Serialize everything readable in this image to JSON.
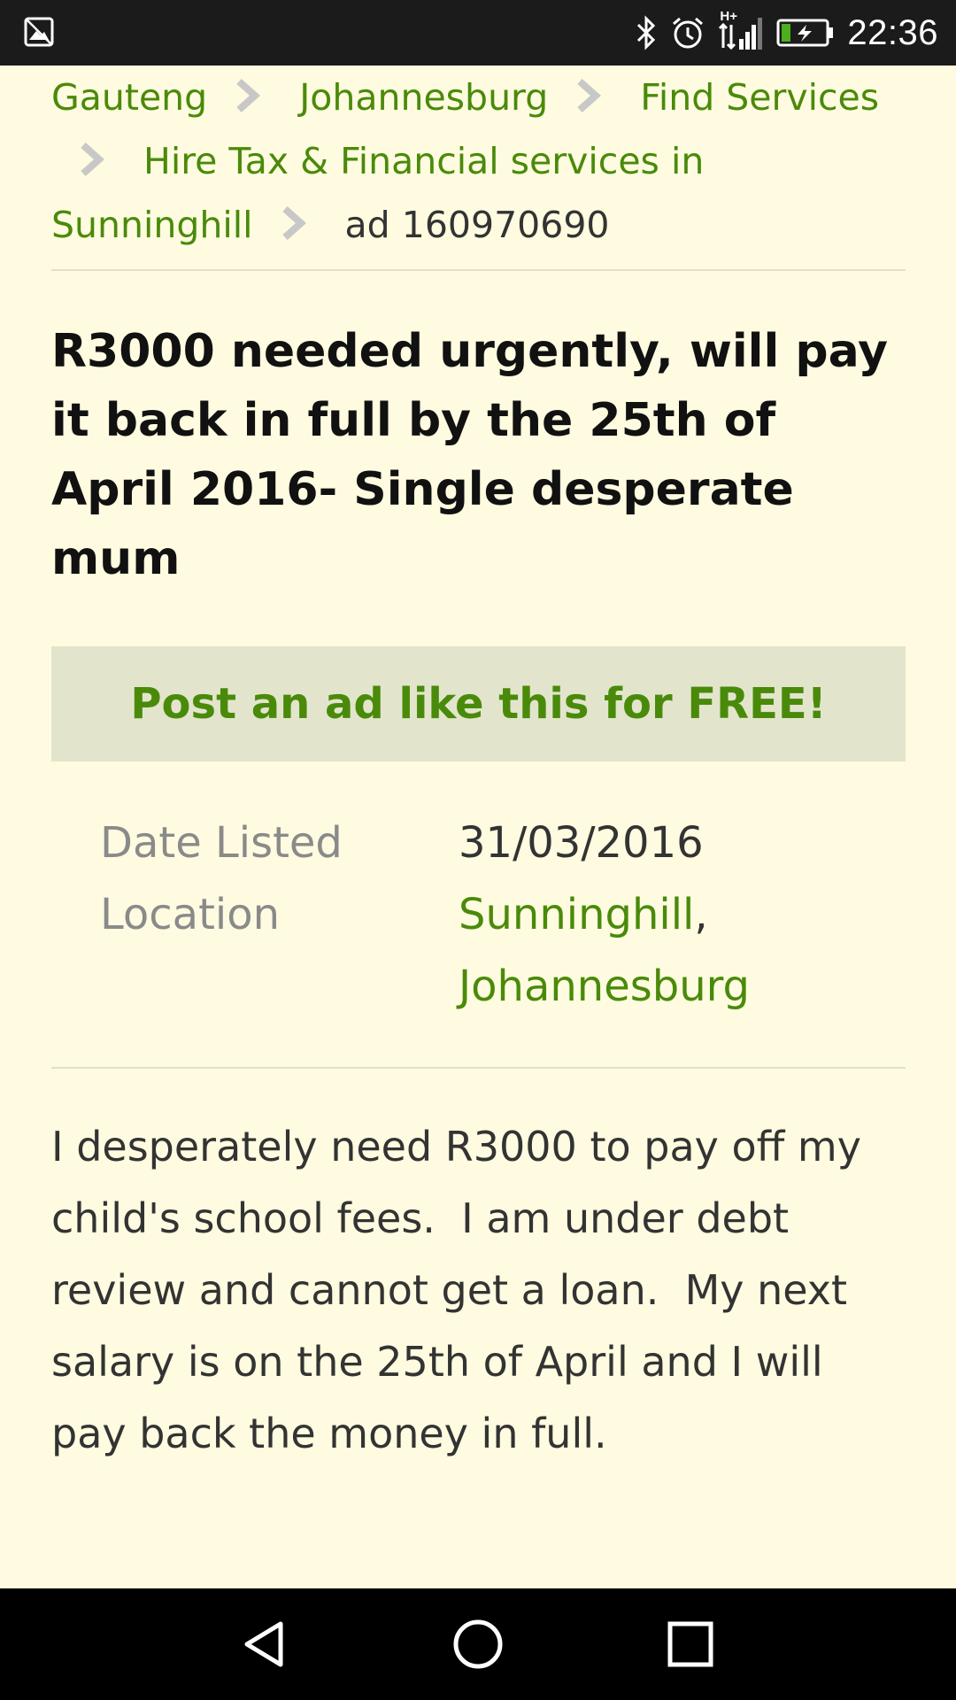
{
  "status_bar": {
    "time": "22:36",
    "network": "H+",
    "icons": [
      "image-notification-icon",
      "bluetooth-icon",
      "alarm-icon",
      "signal-icon",
      "battery-charging-icon"
    ]
  },
  "breadcrumb": {
    "items": [
      {
        "label": "Gauteng"
      },
      {
        "label": "Johannesburg"
      },
      {
        "label": "Find Services"
      },
      {
        "label": "Hire Tax & Financial services  in Sunninghill"
      }
    ],
    "current": "ad 160970690"
  },
  "ad": {
    "title": "R3000 needed urgently, will pay it back in full by the 25th of April 2016- Single desperate mum",
    "post_ad_label": "Post an ad like this for FREE!",
    "details": {
      "date_label": "Date Listed",
      "date_value": "31/03/2016",
      "location_label": "Location",
      "location_suburb": "Sunninghill",
      "location_separator": ",",
      "location_city": "Johannesburg"
    },
    "description": "I desperately need R3000 to pay off my child's school fees.  I am under debt review and cannot get a loan.  My next salary is on the 25th of April and I will pay back the money in full."
  },
  "colors": {
    "background": "#fefbe0",
    "link": "#4a8a0a",
    "banner": "#e2e5cc",
    "status_bar": "#1b1b1b",
    "nav_bar": "#000000"
  },
  "nav_bar": {
    "buttons": [
      "back-icon",
      "home-icon",
      "recents-icon"
    ]
  }
}
